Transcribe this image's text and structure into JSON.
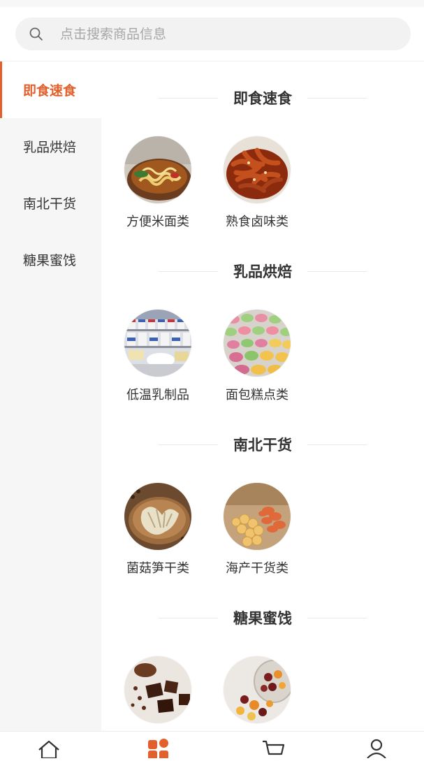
{
  "search": {
    "placeholder": "点击搜索商品信息",
    "icon": "search-icon"
  },
  "accent_color": "#e35f2b",
  "sidebar": {
    "active_index": 0,
    "items": [
      {
        "label": "即食速食"
      },
      {
        "label": "乳品烘焙"
      },
      {
        "label": "南北干货"
      },
      {
        "label": "糖果蜜饯"
      }
    ]
  },
  "sections": [
    {
      "title": "即食速食",
      "items": [
        {
          "label": "方便米面类",
          "image": "noodle-bowl-image"
        },
        {
          "label": "熟食卤味类",
          "image": "braised-chicken-feet-image"
        }
      ]
    },
    {
      "title": "乳品烘焙",
      "items": [
        {
          "label": "低温乳制品",
          "image": "dairy-fridge-image"
        },
        {
          "label": "面包糕点类",
          "image": "macarons-image"
        }
      ]
    },
    {
      "title": "南北干货",
      "items": [
        {
          "label": "菌菇笋干类",
          "image": "dried-mushrooms-image"
        },
        {
          "label": "海产干货类",
          "image": "dried-seafood-image"
        }
      ]
    },
    {
      "title": "糖果蜜饯",
      "items": [
        {
          "label": "",
          "image": "chocolate-candy-image"
        },
        {
          "label": "",
          "image": "dried-fruit-jar-image"
        }
      ]
    }
  ],
  "tabbar": {
    "active_index": 1,
    "items": [
      {
        "icon": "home-icon"
      },
      {
        "icon": "category-icon"
      },
      {
        "icon": "cart-icon"
      },
      {
        "icon": "user-icon"
      }
    ]
  }
}
